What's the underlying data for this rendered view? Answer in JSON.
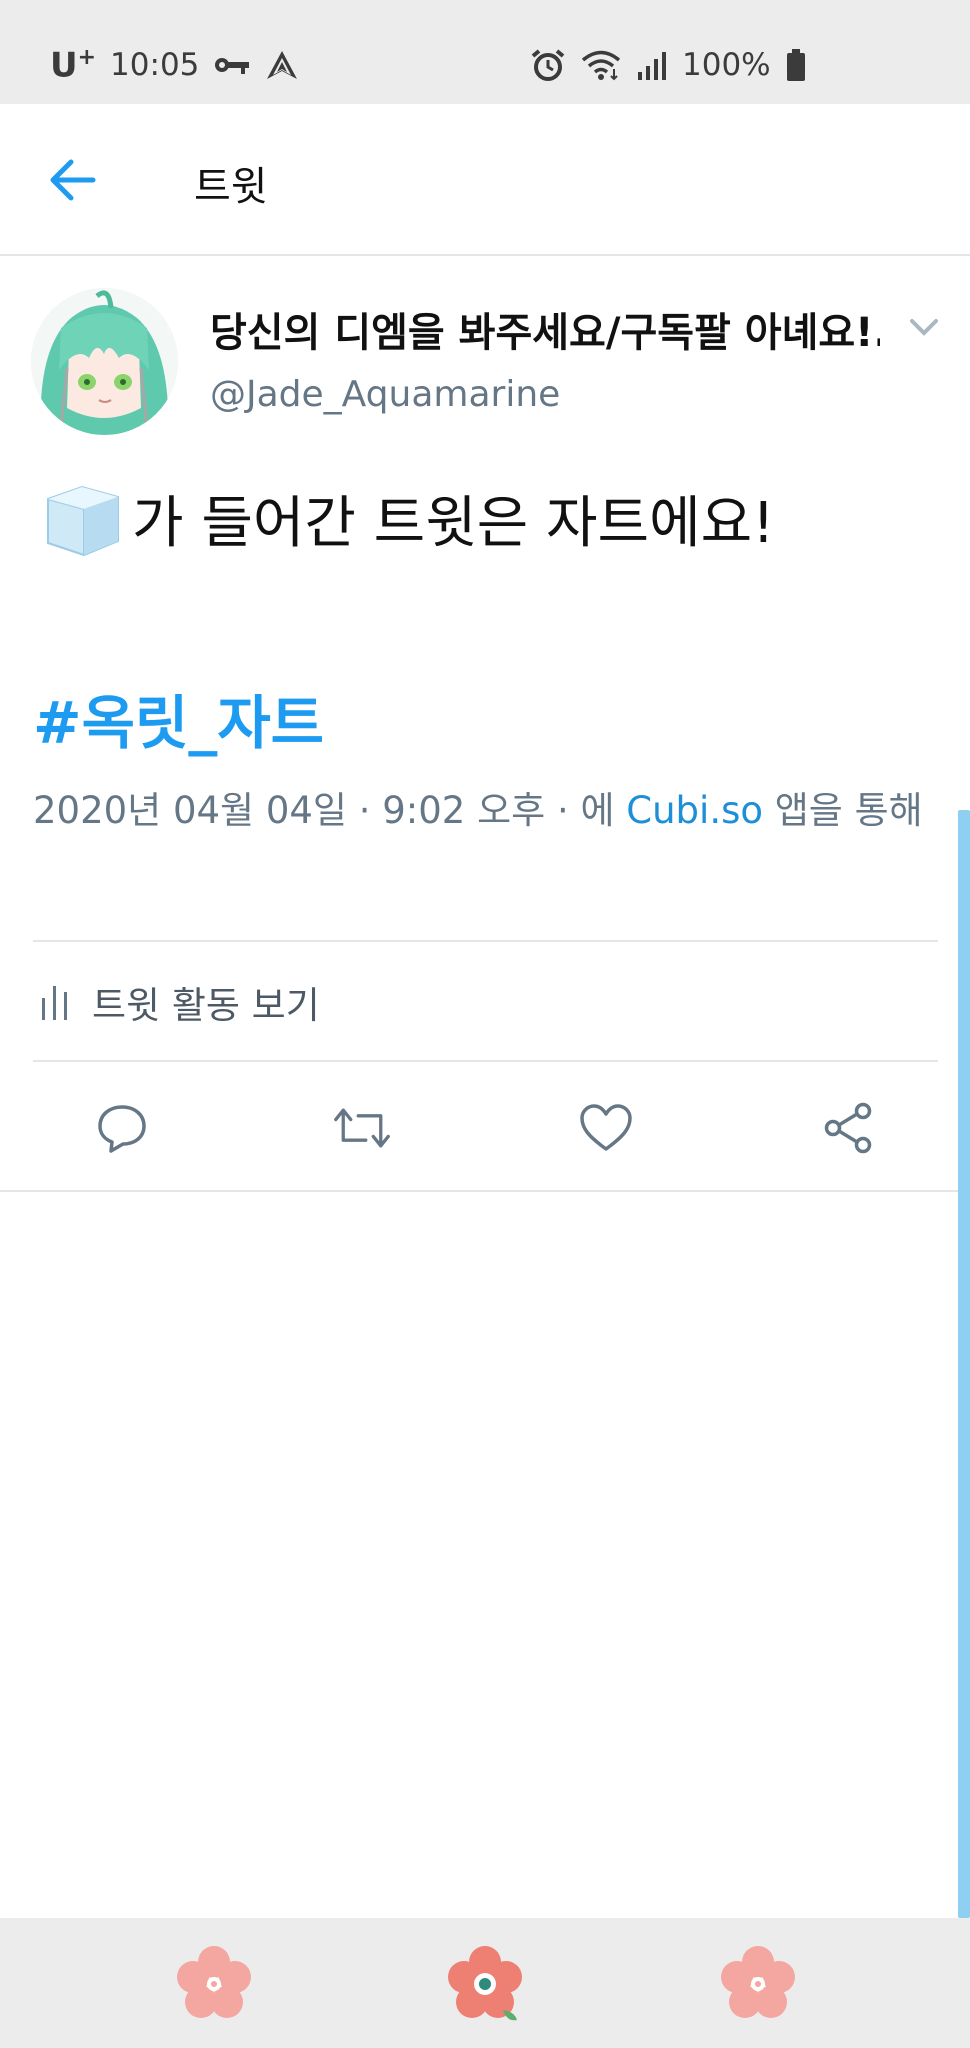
{
  "status_bar": {
    "carrier": "U",
    "carrier_sup": "+",
    "time": "10:05",
    "battery": "100%",
    "icons": [
      "key-icon",
      "navigation-icon",
      "alarm-icon",
      "wifi-icon",
      "signal-icon",
      "battery-icon"
    ]
  },
  "header": {
    "title": "트윗",
    "back_icon": "arrow-left-icon"
  },
  "tweet": {
    "display_name": "당신의 디엠을 봐주세요/구독팔 아녜요!...",
    "handle": "@Jade_Aquamarine",
    "text": "가 들어간 트윗은 자트에요!",
    "text_emoji": "ice-cube-icon",
    "hashtag": "#옥릿_자트",
    "meta_prefix": "2020년 04월 04일 · 9:02 오후 · 에 ",
    "via_app": "Cubi.so",
    "meta_suffix": " 앱을 통해",
    "activity_label": "트윗 활동 보기"
  },
  "actions": [
    "reply-icon",
    "retweet-icon",
    "like-icon",
    "share-icon"
  ],
  "colors": {
    "accent": "#1d9bf0",
    "secondary_text": "#657786",
    "divider": "#e3e6e8",
    "status_bar_bg": "#ececec",
    "scrollbar": "#8ecff2",
    "flower": "#f3a7a0"
  }
}
